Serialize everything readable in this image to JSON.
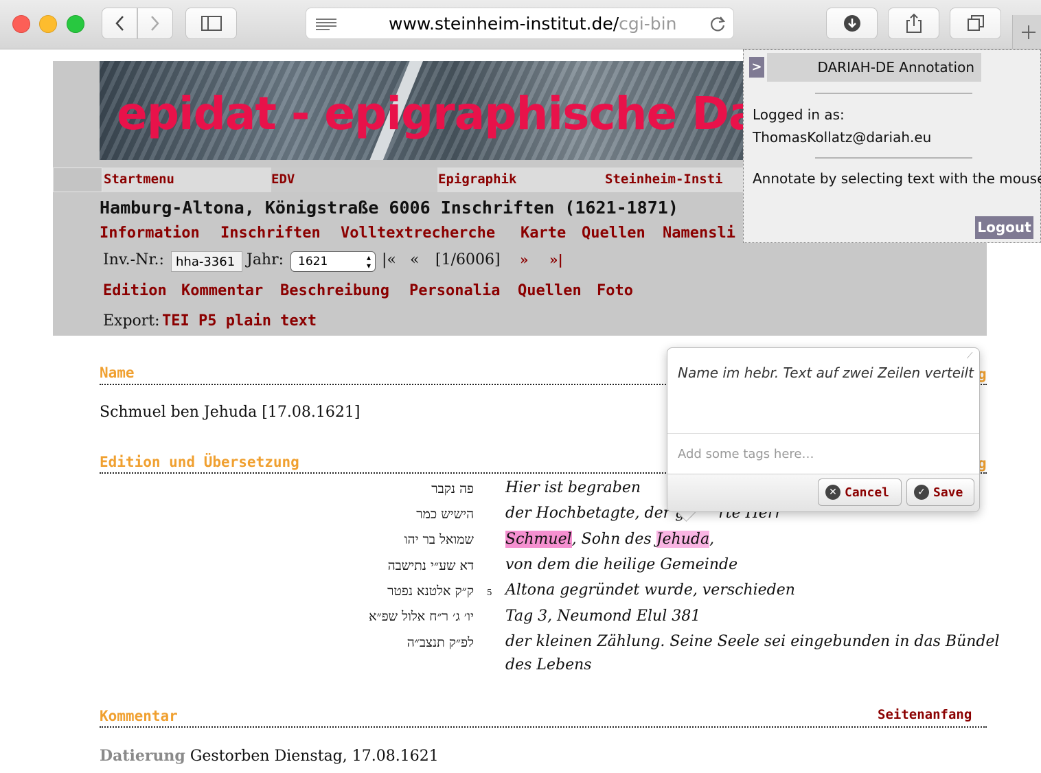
{
  "browser": {
    "url_main": "www.steinheim-institut.de/",
    "url_dim": "cgi-bin"
  },
  "banner": {
    "title": "epidat - epigraphische Date"
  },
  "menu": [
    "Startmenu",
    "EDV",
    "Epigraphik",
    "Steinheim-Insti"
  ],
  "site_title": "Hamburg-Altona, Königstraße 6006 Inschriften (1621-1871)",
  "subnav": [
    "Information",
    "Inschriften",
    "Volltextrecherche",
    "Karte",
    "Quellen",
    "Namensli"
  ],
  "navigation": {
    "inv_label": "Inv.-Nr.:",
    "inv_value": "hha-3361",
    "year_label": "Jahr:",
    "year_value": "1621",
    "first": "|«",
    "prev": "«",
    "position": "[1/6006]",
    "next": "»",
    "last": "»|"
  },
  "tabs": [
    "Edition",
    "Kommentar",
    "Beschreibung",
    "Personalia",
    "Quellen",
    "Foto"
  ],
  "export": {
    "label": "Export:",
    "link": "TEI P5 plain text"
  },
  "sections": {
    "name_heading": "Name",
    "name_heading_tail": "g",
    "name_value": "Schmuel ben Jehuda [17.08.1621]",
    "edition_heading": "Edition und Übersetzung",
    "edition_heading_tail": "g",
    "kommentar_heading": "Kommentar",
    "top_link": "Seitenanfang"
  },
  "edition": {
    "line_number": "5",
    "hebrew": [
      "פה נקבר",
      "הישיש כמר",
      "שמואל בר יהו",
      "דא שע״י נתישבה",
      "ק״ק אלטנא נפטר",
      "יו׳ ג׳ ר״ח אלול שפ״א",
      "לפ״ק תנצב״ה"
    ],
    "translation": {
      "l1": "Hier ist begraben",
      "l2": "der Hochbetagte, der ge",
      "l2_tail": "rte Herr",
      "l3_a": "Schmuel",
      "l3_b": ", Sohn des ",
      "l3_c": "Jehuda",
      "l3_d": ",",
      "l4": "von dem die heilige Gemeinde",
      "l5": "Altona gegründet wurde, verschieden",
      "l6": "Tag 3, Neumond Elul 381",
      "l7": "der kleinen Zählung. Seine Seele sei eingebunden in das Bündel",
      "l8": "des Lebens"
    }
  },
  "kommentar": {
    "label": "Datierung",
    "value": " Gestorben Dienstag, 17.08.1621"
  },
  "dariah": {
    "toggle": ">",
    "title": "DARIAH-DE Annotation",
    "logged_in_label": "Logged in as:",
    "user": "ThomasKollatz@dariah.eu",
    "hint": "Annotate by selecting text with the mouse",
    "logout": "Logout"
  },
  "editor": {
    "text": "Name im  hebr. Text auf zwei Zeilen verteilt",
    "tags_placeholder": "Add some tags here…",
    "cancel": "Cancel",
    "save": "Save"
  },
  "colors": {
    "link_red": "#8b0000",
    "section_orange": "#f0a030",
    "highlight": "#f590d0",
    "banner_red": "#e8124a"
  }
}
